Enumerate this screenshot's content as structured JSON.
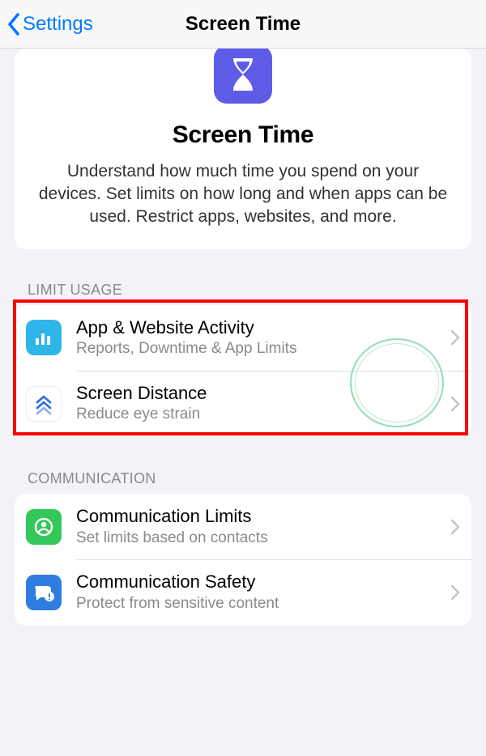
{
  "nav": {
    "back_label": "Settings",
    "title": "Screen Time"
  },
  "hero": {
    "title": "Screen Time",
    "description": "Understand how much time you spend on your devices. Set limits on how long and when apps can be used. Restrict apps, websites, and more."
  },
  "sections": {
    "limit_usage": {
      "heading": "LIMIT USAGE",
      "items": [
        {
          "title": "App & Website Activity",
          "subtitle": "Reports, Downtime & App Limits"
        },
        {
          "title": "Screen Distance",
          "subtitle": "Reduce eye strain"
        }
      ]
    },
    "communication": {
      "heading": "COMMUNICATION",
      "items": [
        {
          "title": "Communication Limits",
          "subtitle": "Set limits based on contacts"
        },
        {
          "title": "Communication Safety",
          "subtitle": "Protect from sensitive content"
        }
      ]
    }
  }
}
